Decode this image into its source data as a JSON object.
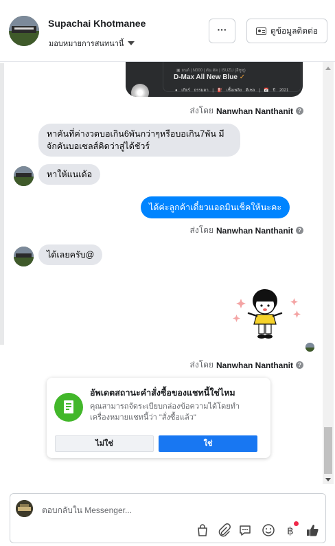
{
  "header": {
    "name": "Supachai Khotmanee",
    "assign_label": "มอบหมายการสนทนานี้",
    "more_label": "···",
    "contact_label": "ดูข้อมูลติดต่อ"
  },
  "image_card": {
    "meta": "▣ ยนต์ | N000 | ดัน ดัด | ISUZU (อีซูซุ)",
    "title": "D-Max All New Blue",
    "sub": "● เกียร์ ธรรมดา | ⛽ เชื้อเพลิง ดีเซล | 📅 ปี 2021"
  },
  "sent_by_prefix": "ส่งโดย",
  "agent_name": "Nanwhan Nanthanit",
  "messages": {
    "incoming_1": "หาคันที่ค่างวดบอเกิน6พันกว่าๆหรือบอเกิน7พัน มีจักคันบอเซลส์คิดว่าสู่ได้ชัวร์",
    "incoming_2": "หาให้แนเด้อ",
    "outgoing_1": "ได้ค่ะลูกค้าเดี๋ยวแอดมินเช็คให้นะคะ",
    "incoming_3": "ได้เลยครับ@"
  },
  "prompt": {
    "title": "อัพเดตสถานะคำสั่งซื้อของแชทนี้ใช่ไหม",
    "description": "คุณสามารถจัดระเบียบกล่องข้อความได้โดยทำเครื่องหมายแชทนี้ว่า \"สั่งซื้อแล้ว\"",
    "no_label": "ไม่ใช่",
    "yes_label": "ใช่"
  },
  "composer": {
    "placeholder": "ตอบกลับใน Messenger..."
  },
  "colors": {
    "accent": "#0084ff",
    "primary_button": "#1877f2",
    "incoming_bubble": "#e4e6eb",
    "prompt_icon": "#42b72a",
    "notification_dot": "#f02849"
  },
  "icons": [
    "chevron-down-icon",
    "contact-card-icon",
    "info-icon",
    "order-icon",
    "shopping-bag-icon",
    "paperclip-icon",
    "saved-reply-icon",
    "emoji-icon",
    "baht-icon",
    "thumbs-up-icon"
  ]
}
